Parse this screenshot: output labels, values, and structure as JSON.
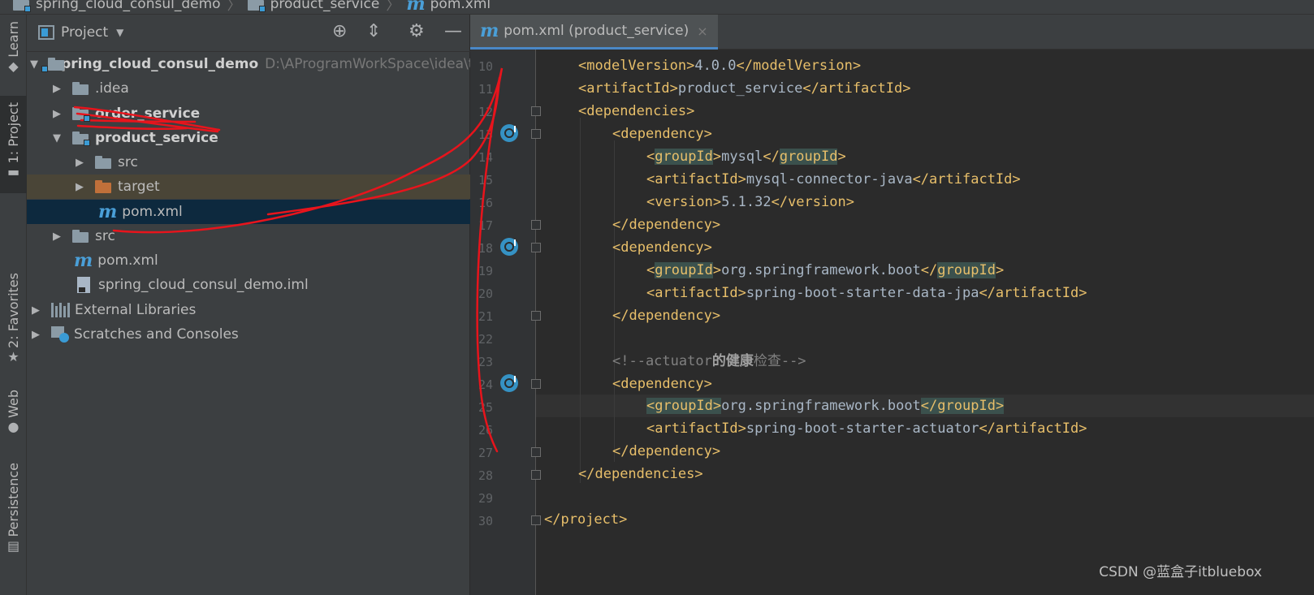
{
  "breadcrumb": {
    "items": [
      "spring_cloud_consul_demo",
      "product_service",
      "pom.xml"
    ]
  },
  "toolstrip": {
    "tabs": [
      "Learn",
      "1: Project",
      "2: Favorites",
      "Web",
      "Persistence"
    ]
  },
  "project_panel": {
    "title": "Project",
    "tree": [
      {
        "label": "spring_cloud_consul_demo",
        "path": "D:\\AProgramWorkSpace\\idea\\te"
      },
      {
        "label": ".idea"
      },
      {
        "label": "order_service"
      },
      {
        "label": "product_service"
      },
      {
        "label": "src"
      },
      {
        "label": "target"
      },
      {
        "label": "pom.xml"
      },
      {
        "label": "src"
      },
      {
        "label": "pom.xml"
      },
      {
        "label": "spring_cloud_consul_demo.iml"
      },
      {
        "label": "External Libraries"
      },
      {
        "label": "Scratches and Consoles"
      }
    ]
  },
  "editor": {
    "tab_label": "pom.xml (product_service)",
    "tab_close": "×",
    "line_numbers": [
      "10",
      "11",
      "12",
      "13",
      "14",
      "15",
      "16",
      "17",
      "18",
      "19",
      "20",
      "21",
      "22",
      "23",
      "24",
      "25",
      "26",
      "27",
      "28",
      "29",
      "30"
    ],
    "code": {
      "l10_tag": "modelVersion",
      "l10_val": "4.0.0",
      "l11_tag": "artifactId",
      "l11_val": "product_service",
      "l12_tag": "dependencies",
      "dep_tag": "dependency",
      "group_tag": "groupId",
      "artifact_tag": "artifactId",
      "version_tag": "version",
      "l14_val": "mysql",
      "l15_val": "mysql-connector-java",
      "l16_val": "5.1.32",
      "l19_val": "org.springframework.boot",
      "l20_val": "spring-boot-starter-data-jpa",
      "l23_open": "<!--actuator",
      "l23_bold": "的健康",
      "l23_rest": "检查-->",
      "l25_val": "org.springframework.boot",
      "l26_val": "spring-boot-starter-actuator",
      "l30_tag": "project"
    }
  },
  "watermark": "CSDN @蓝盒子itbluebox",
  "colors": {
    "accent": "#4a88c7",
    "annotation": "#e8141c",
    "tag": "#e8bf6a",
    "text": "#a9b7c6"
  }
}
